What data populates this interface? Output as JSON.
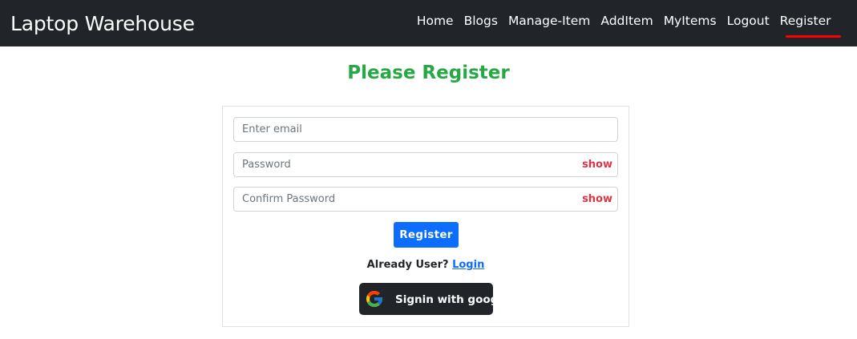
{
  "navbar": {
    "brand": "Laptop Warehouse",
    "links": [
      "Home",
      "Blogs",
      "Manage-Item",
      "AddItem",
      "MyItems",
      "Logout",
      "Register"
    ],
    "active": "Register",
    "active_color": "#ff0000"
  },
  "page": {
    "title": "Please Register",
    "title_color": "#28a745"
  },
  "form": {
    "email_placeholder": "Enter email",
    "password_placeholder": "Password",
    "confirm_placeholder": "Confirm Password",
    "show_label": "show",
    "register_label": "Register",
    "already_text": "Already User?",
    "login_label": "Login",
    "google_label": "Signin with google",
    "google_icon": "google-g-icon"
  }
}
